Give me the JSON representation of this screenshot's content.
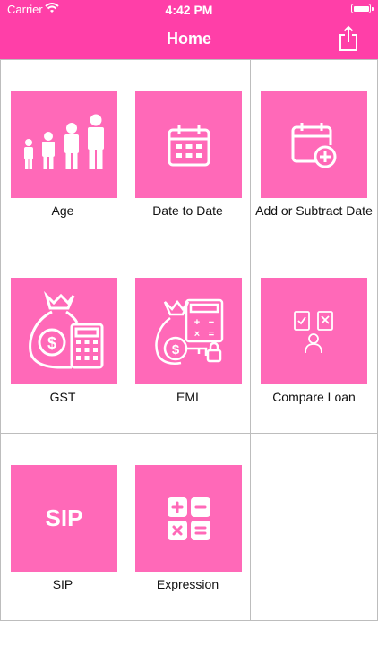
{
  "status_bar": {
    "carrier": "Carrier",
    "time": "4:42 PM"
  },
  "nav": {
    "title": "Home"
  },
  "grid": {
    "items": [
      {
        "label": "Age",
        "icon": "family-icon"
      },
      {
        "label": "Date to Date",
        "icon": "calendar-icon"
      },
      {
        "label": "Add or Subtract Date",
        "icon": "calendar-add-icon"
      },
      {
        "label": "GST",
        "icon": "money-bag-calculator-icon"
      },
      {
        "label": "EMI",
        "icon": "loan-calculator-icon"
      },
      {
        "label": "Compare Loan",
        "icon": "compare-documents-icon"
      },
      {
        "label": "SIP",
        "icon": "sip-icon",
        "icon_text": "SIP"
      },
      {
        "label": "Expression",
        "icon": "math-operators-icon"
      }
    ]
  },
  "colors": {
    "nav_bar": "#ff3fa8",
    "tile": "#ff69b8",
    "grid_line": "#bdbdbd"
  }
}
